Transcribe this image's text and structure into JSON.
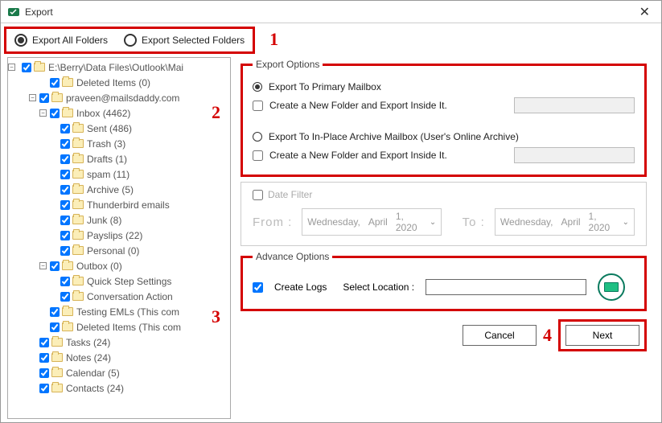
{
  "window": {
    "title": "Export"
  },
  "annotations": {
    "a1": "1",
    "a2": "2",
    "a3": "3",
    "a4": "4"
  },
  "top_radio": {
    "export_all": "Export All Folders",
    "export_selected": "Export Selected Folders",
    "selected": "all"
  },
  "tree": {
    "root": "E:\\Berry\\Data Files\\Outlook\\Mai",
    "items": [
      {
        "indent": 3,
        "label": "Deleted Items (0)"
      },
      {
        "indent": 2,
        "label": "praveen@mailsdaddy.com",
        "expandable": "minus"
      },
      {
        "indent": 3,
        "label": "Inbox (4462)",
        "expandable": "minus"
      },
      {
        "indent": 4,
        "label": "Sent (486)"
      },
      {
        "indent": 4,
        "label": "Trash (3)"
      },
      {
        "indent": 4,
        "label": "Drafts (1)"
      },
      {
        "indent": 4,
        "label": "spam (11)"
      },
      {
        "indent": 4,
        "label": "Archive (5)"
      },
      {
        "indent": 4,
        "label": "Thunderbird emails"
      },
      {
        "indent": 4,
        "label": "Junk (8)"
      },
      {
        "indent": 4,
        "label": "Payslips (22)"
      },
      {
        "indent": 4,
        "label": "Personal (0)"
      },
      {
        "indent": 3,
        "label": "Outbox (0)",
        "expandable": "minus"
      },
      {
        "indent": 4,
        "label": "Quick Step Settings"
      },
      {
        "indent": 4,
        "label": "Conversation Action"
      },
      {
        "indent": 3,
        "label": "Testing EMLs (This com"
      },
      {
        "indent": 3,
        "label": "Deleted Items (This com"
      },
      {
        "indent": 2,
        "label": "Tasks (24)"
      },
      {
        "indent": 2,
        "label": "Notes (24)"
      },
      {
        "indent": 2,
        "label": "Calendar (5)"
      },
      {
        "indent": 2,
        "label": "Contacts (24)"
      }
    ]
  },
  "export_options": {
    "legend": "Export Options",
    "primary_label": "Export To Primary Mailbox",
    "create_new1": "Create a New Folder and Export Inside It.",
    "archive_label": "Export To In-Place Archive Mailbox (User's Online Archive)",
    "create_new2": "Create a New Folder and Export Inside It.",
    "folder1": "",
    "folder2": ""
  },
  "date_filter": {
    "label": "Date Filter",
    "from": "From :",
    "to": "To :",
    "from_val": {
      "day": "Wednesday,",
      "month": "April",
      "date": "1, 2020"
    },
    "to_val": {
      "day": "Wednesday,",
      "month": "April",
      "date": "1, 2020"
    }
  },
  "advance": {
    "legend": "Advance Options",
    "create_logs": "Create Logs",
    "select_location": "Select Location :",
    "location": ""
  },
  "buttons": {
    "cancel": "Cancel",
    "next": "Next"
  }
}
